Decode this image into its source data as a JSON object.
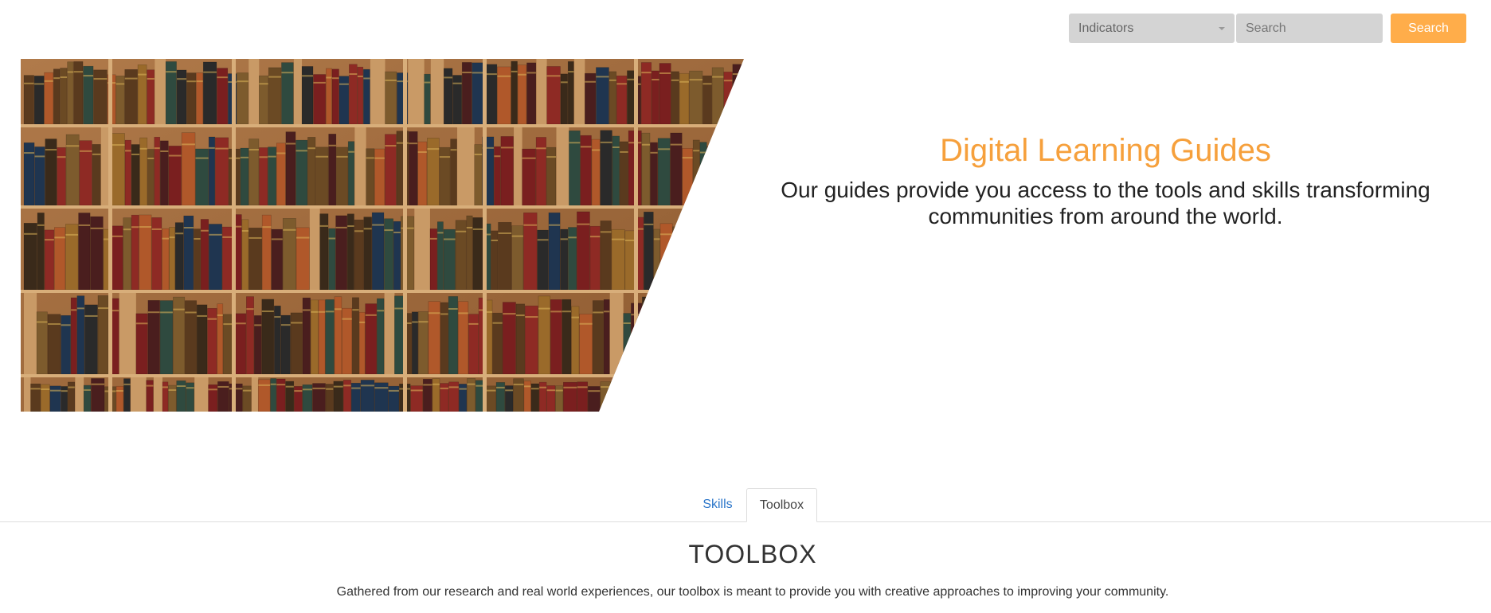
{
  "search": {
    "category_selected": "Indicators",
    "input_placeholder": "Search",
    "input_value": "",
    "button_label": "Search"
  },
  "hero": {
    "image_icon": "bookshelf-image",
    "title": "Digital Learning Guides",
    "subtitle": "Our guides provide you access to the tools and skills transforming communities from around the world."
  },
  "tabs": [
    {
      "label": "Skills",
      "active": false
    },
    {
      "label": "Toolbox",
      "active": true
    }
  ],
  "section": {
    "title": "TOOLBOX",
    "description": "Gathered from our research and real world experiences, our toolbox is meant to provide you with creative approaches to improving your community."
  },
  "colors": {
    "accent_orange": "#f6a03c",
    "search_button": "#ffad4a",
    "link_blue": "#2a75c9",
    "input_gray": "#d4d4d4"
  }
}
